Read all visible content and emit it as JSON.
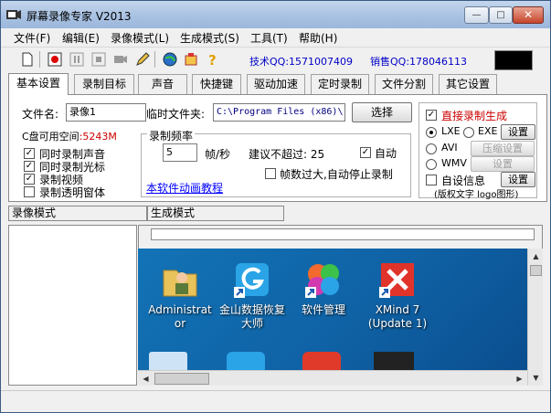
{
  "window": {
    "title": "屏幕录像专家 V2013",
    "min": "—",
    "max": "□",
    "close": "✕"
  },
  "menu": [
    "文件(F)",
    "编辑(E)",
    "录像模式(L)",
    "生成模式(S)",
    "工具(T)",
    "帮助(H)"
  ],
  "toolbar": {
    "qq_tech": "技术QQ:1571007409",
    "qq_sales": "销售QQ:178046113"
  },
  "tabs": [
    "基本设置",
    "录制目标",
    "声音",
    "快捷键",
    "驱动加速",
    "定时录制",
    "文件分割",
    "其它设置"
  ],
  "basic": {
    "filename_label": "文件名:",
    "filename_value": "录像1",
    "tempdir_label": "临时文件夹:",
    "tempdir_value": "C:\\Program Files (x86)\\",
    "browse_button": "选择",
    "disk_label": "C盘可用空间",
    "disk_value": ":5243M",
    "record_sound": "同时录制声音",
    "record_cursor": "同时录制光标",
    "record_video": "录制视频",
    "record_transparent": "录制透明窗体",
    "fps_group": "录制频率",
    "fps_value": "5",
    "fps_unit": "帧/秒",
    "suggest_label": "建议不超过: 25",
    "auto_label": "自动",
    "auto_stop_label": "帧数过大,自动停止录制",
    "tutorial_link": "本软件动画教程",
    "direct_record": "直接录制生成",
    "lxe": "LXE",
    "exe": "EXE",
    "avi": "AVI",
    "wmv": "WMV",
    "settings_button": "设置",
    "compress_button": "压缩设置",
    "settings_button2": "设置",
    "custom_info": "自设信息",
    "settings_button3": "设置",
    "copyright_note": "(版权文字 logo图形)"
  },
  "lower": {
    "record_mode_tab": "录像模式",
    "generate_mode_tab": "生成模式"
  },
  "desktop_icons": [
    {
      "label": "Administrat or",
      "icon": "user-folder-icon"
    },
    {
      "label": "金山数据恢复大师",
      "icon": "data-recovery-icon"
    },
    {
      "label": "软件管理",
      "icon": "software-manager-icon"
    },
    {
      "label": "XMind 7 (Update 1)",
      "icon": "xmind-icon"
    }
  ],
  "colors": {
    "accent_red": "#cc0000",
    "link_blue": "#0000ff",
    "desktop_blue": "#0f62a5"
  }
}
